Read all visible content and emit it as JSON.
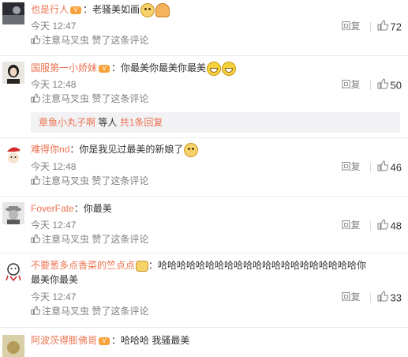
{
  "comments": [
    {
      "name": "也是行人",
      "vip": "V",
      "colon": "：",
      "text": "老骚美如画",
      "emojis": [
        "cat",
        "pray"
      ],
      "time": "今天 12:47",
      "reply": "回复",
      "likes": "72",
      "sub_user": "注意马叉虫",
      "sub_action": "赞了这条评论"
    },
    {
      "name": "国服第一小娇妹",
      "vip": "V",
      "colon": "：",
      "text": "你最美你最美你最美",
      "emojis": [
        "laugh",
        "laugh"
      ],
      "time": "今天 12:48",
      "reply": "回复",
      "likes": "50",
      "sub_user": "注意马叉虫",
      "sub_action": "赞了这条评论"
    },
    {
      "name": "难得你nd",
      "vip": "",
      "colon": "：",
      "text": "你是我见过最美的新娘了",
      "emojis": [
        "cat"
      ],
      "time": "今天 12:48",
      "reply": "回复",
      "likes": "46",
      "sub_user": "注意马叉虫",
      "sub_action": "赞了这条评论"
    },
    {
      "name": "FoverFate",
      "vip": "",
      "colon": "：",
      "text": "你最美",
      "emojis": [],
      "time": "今天 12:47",
      "reply": "回复",
      "likes": "48",
      "sub_user": "注意马叉虫",
      "sub_action": "赞了这条评论"
    },
    {
      "name": "不要葱多点香菜的竺点点",
      "vip": "",
      "colon": "：",
      "text": "哈哈哈哈哈哈哈哈哈哈哈哈哈哈哈哈哈哈哈哈哈你",
      "text2": "最美你最美",
      "emojis": [],
      "time": "今天 12:47",
      "reply": "回复",
      "likes": "33",
      "sub_user": "注意马叉虫",
      "sub_action": "赞了这条评论"
    },
    {
      "name": "阿波茨得膨佛哥",
      "vip": "V",
      "colon": "：",
      "text": "哈哈哈 我骚最美",
      "emojis": []
    }
  ],
  "reply_thread": {
    "user": "章鱼小丸子啊",
    "middle": " 等人 ",
    "count": "共1条回复"
  },
  "colors": {
    "name": "#eb7350",
    "muted": "#808080",
    "thread_bg": "#f2f2f5"
  }
}
